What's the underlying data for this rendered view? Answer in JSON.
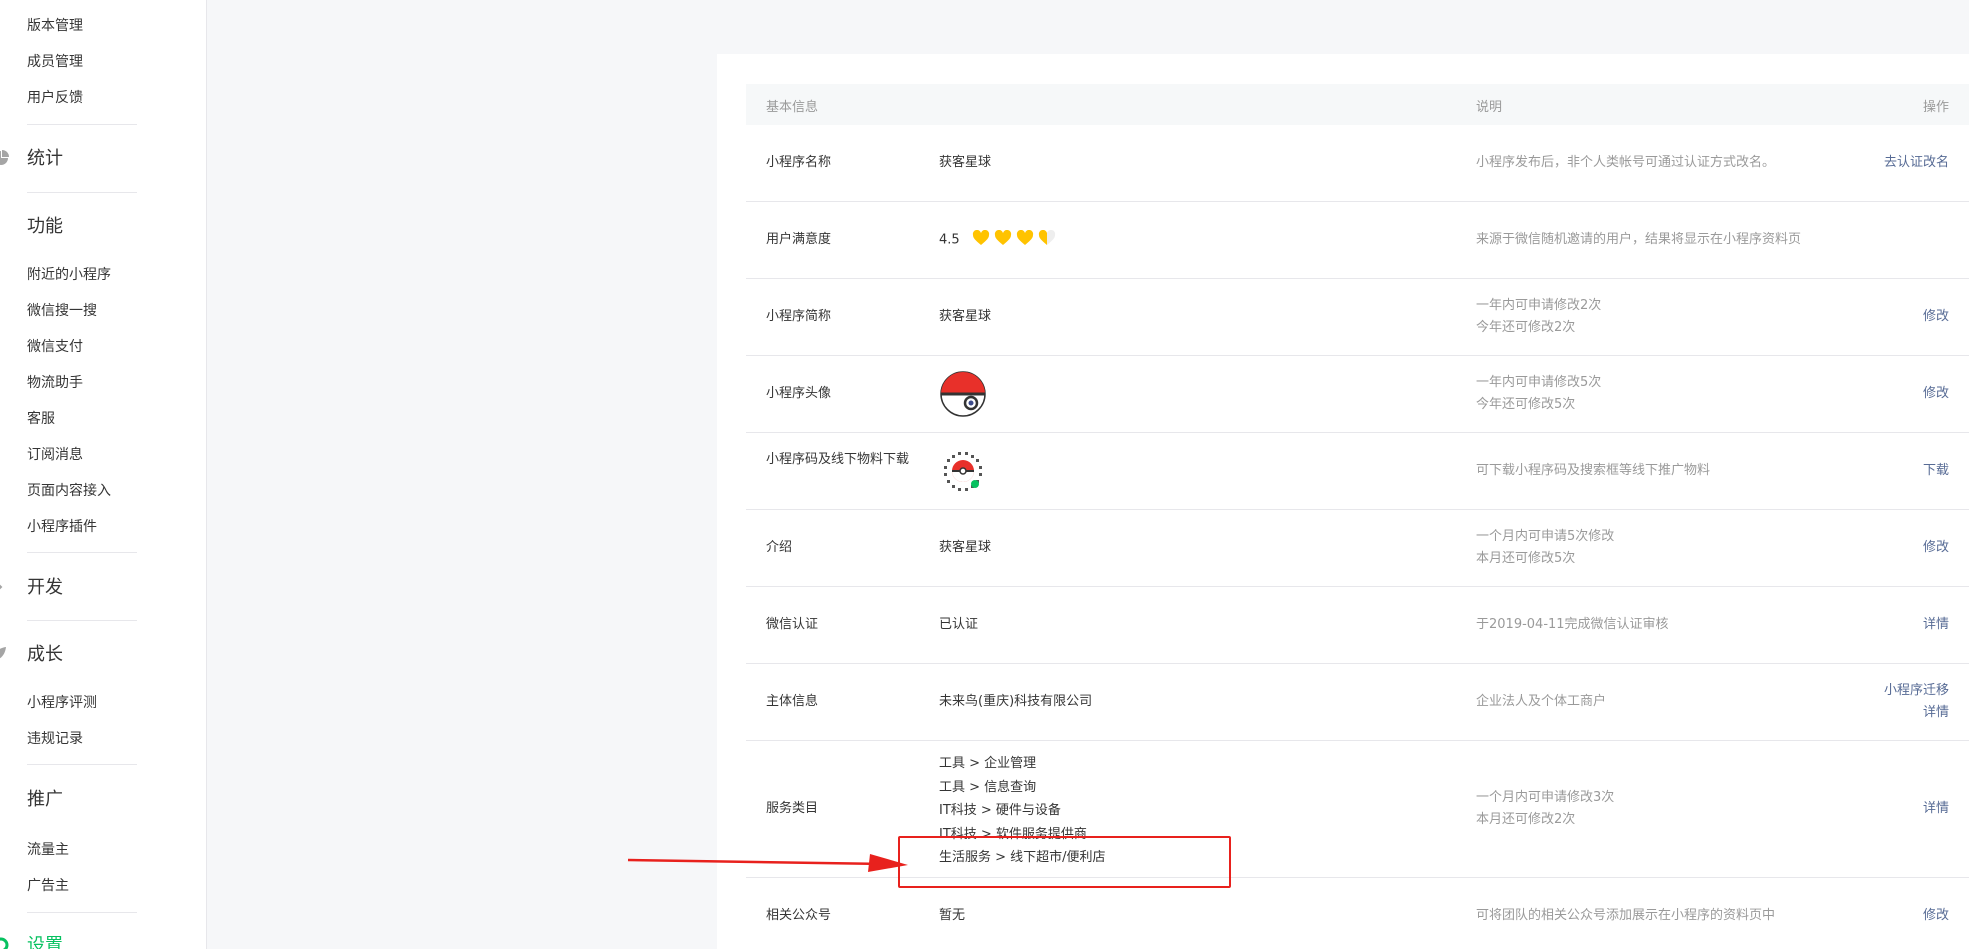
{
  "sidebar": {
    "top_items": [
      {
        "label": "版本管理"
      },
      {
        "label": "成员管理"
      },
      {
        "label": "用户反馈"
      }
    ],
    "groups": {
      "stats": {
        "label": "统计",
        "icon": "pie-chart-icon"
      },
      "features": {
        "label": "功能",
        "icon": "grid-icon",
        "items": [
          {
            "label": "附近的小程序"
          },
          {
            "label": "微信搜一搜"
          },
          {
            "label": "微信支付"
          },
          {
            "label": "物流助手"
          },
          {
            "label": "客服"
          },
          {
            "label": "订阅消息"
          },
          {
            "label": "页面内容接入"
          },
          {
            "label": "小程序插件"
          }
        ]
      },
      "dev": {
        "label": "开发",
        "icon": "code-icon"
      },
      "growth": {
        "label": "成长",
        "icon": "leaf-icon",
        "items": [
          {
            "label": "小程序评测"
          },
          {
            "label": "违规记录"
          }
        ]
      },
      "promo": {
        "label": "推广",
        "icon": "megaphone-icon",
        "items": [
          {
            "label": "流量主"
          },
          {
            "label": "广告主"
          }
        ]
      },
      "settings": {
        "label": "设置",
        "icon": "gear-icon"
      }
    }
  },
  "table": {
    "headers": {
      "basic": "基本信息",
      "desc": "说明",
      "op": "操作"
    },
    "rows": {
      "name": {
        "label": "小程序名称",
        "value": "获客星球",
        "desc": "小程序发布后，非个人类帐号可通过认证方式改名。",
        "op": "去认证改名"
      },
      "rating": {
        "label": "用户满意度",
        "value": "4.5",
        "stars": 4.5,
        "desc": "来源于微信随机邀请的用户，结果将显示在小程序资料页"
      },
      "short": {
        "label": "小程序简称",
        "value": "获客星球",
        "desc1": "一年内可申请修改2次",
        "desc2": "今年还可修改2次",
        "op": "修改"
      },
      "avatar": {
        "label": "小程序头像",
        "desc1": "一年内可申请修改5次",
        "desc2": "今年还可修改5次",
        "op": "修改"
      },
      "code": {
        "label": "小程序码及线下物料下载",
        "desc": "可下载小程序码及搜索框等线下推广物料",
        "op": "下载"
      },
      "intro": {
        "label": "介绍",
        "value": "获客星球",
        "desc1": "一个月内可申请5次修改",
        "desc2": "本月还可修改5次",
        "op": "修改"
      },
      "verify": {
        "label": "微信认证",
        "value": "已认证",
        "desc": "于2019-04-11完成微信认证审核",
        "op": "详情"
      },
      "entity": {
        "label": "主体信息",
        "value": "未来鸟(重庆)科技有限公司",
        "desc": "企业法人及个体工商户",
        "op1": "小程序迁移",
        "op2": "详情"
      },
      "category": {
        "label": "服务类目",
        "values": [
          "工具 > 企业管理",
          "工具 > 信息查询",
          "IT科技 > 硬件与设备",
          "IT科技 > 软件服务提供商",
          "生活服务 > 线下超市/便利店"
        ],
        "desc1": "一个月内可申请修改3次",
        "desc2": "本月还可修改2次",
        "op": "详情"
      },
      "official": {
        "label": "相关公众号",
        "value": "暂无",
        "desc": "可将团队的相关公众号添加展示在小程序的资料页中",
        "op": "修改"
      }
    }
  },
  "colors": {
    "accent": "#07c160",
    "link": "#576b95",
    "annotation": "#e8211d",
    "star": "#ffc300"
  }
}
